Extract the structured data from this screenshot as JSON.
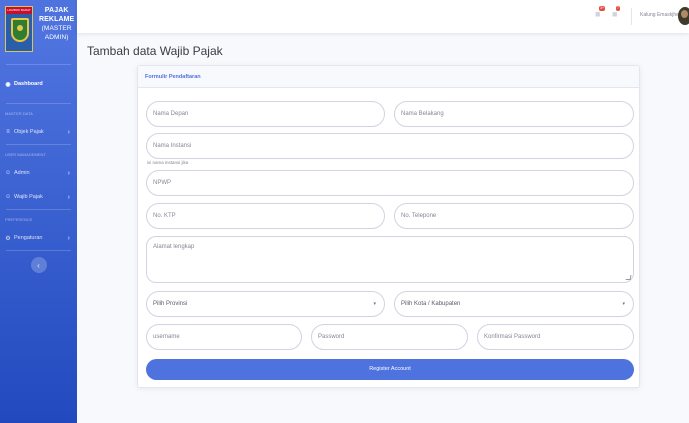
{
  "sidebar": {
    "logo_text": "LOMBOK BARAT",
    "brand_title_1": "PAJAK",
    "brand_title_2": "REKLAME",
    "brand_sub_1": "(MASTER",
    "brand_sub_2": "ADMIN)",
    "dashboard": "Dashboard",
    "heading_master": "MASTER DATA",
    "objek_pajak": "Objek Pajak",
    "heading_user": "USER MANAGEMENT",
    "admin": "Admin",
    "wajib_pajak": "Wajib Pajak",
    "heading_pref": "PREFERENCE",
    "pengaturan": "Pengaturan",
    "toggle_icon": "chevron-left-icon"
  },
  "topbar": {
    "alerts_badge": "3+",
    "messages_badge": "7",
    "username": "Kalung Emaskjheh"
  },
  "page": {
    "title": "Tambah data Wajib Pajak"
  },
  "form": {
    "header": "Formulir Pendaftaran",
    "nama_depan": "Nama Depan",
    "nama_belakang": "Nama Belakang",
    "nama_instansi": "Nama Instansi",
    "instansi_hint": "isi nama instansi jika",
    "npwp": "NPWP",
    "no_ktp": "No. KTP",
    "no_telepone": "No. Telepone",
    "alamat": "Alamat lengkap",
    "provinsi": "Pilih Provinsi",
    "kota": "Pilih Kota / Kabupaten",
    "username": "username",
    "password": "Password",
    "konfirmasi": "Konfirmasi Password",
    "submit": "Register Account"
  },
  "colors": {
    "primary": "#4e73df",
    "sidebar_dark": "#224abe",
    "badge": "#e74a3b"
  }
}
